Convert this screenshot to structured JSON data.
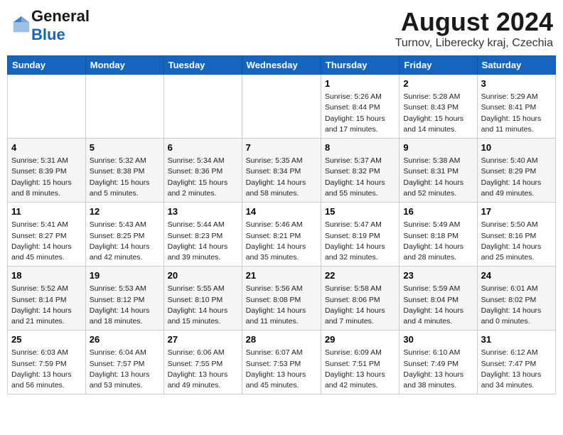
{
  "header": {
    "logo_general": "General",
    "logo_blue": "Blue",
    "month": "August 2024",
    "location": "Turnov, Liberecky kraj, Czechia"
  },
  "weekdays": [
    "Sunday",
    "Monday",
    "Tuesday",
    "Wednesday",
    "Thursday",
    "Friday",
    "Saturday"
  ],
  "weeks": [
    [
      {
        "day": "",
        "info": ""
      },
      {
        "day": "",
        "info": ""
      },
      {
        "day": "",
        "info": ""
      },
      {
        "day": "",
        "info": ""
      },
      {
        "day": "1",
        "info": "Sunrise: 5:26 AM\nSunset: 8:44 PM\nDaylight: 15 hours\nand 17 minutes."
      },
      {
        "day": "2",
        "info": "Sunrise: 5:28 AM\nSunset: 8:43 PM\nDaylight: 15 hours\nand 14 minutes."
      },
      {
        "day": "3",
        "info": "Sunrise: 5:29 AM\nSunset: 8:41 PM\nDaylight: 15 hours\nand 11 minutes."
      }
    ],
    [
      {
        "day": "4",
        "info": "Sunrise: 5:31 AM\nSunset: 8:39 PM\nDaylight: 15 hours\nand 8 minutes."
      },
      {
        "day": "5",
        "info": "Sunrise: 5:32 AM\nSunset: 8:38 PM\nDaylight: 15 hours\nand 5 minutes."
      },
      {
        "day": "6",
        "info": "Sunrise: 5:34 AM\nSunset: 8:36 PM\nDaylight: 15 hours\nand 2 minutes."
      },
      {
        "day": "7",
        "info": "Sunrise: 5:35 AM\nSunset: 8:34 PM\nDaylight: 14 hours\nand 58 minutes."
      },
      {
        "day": "8",
        "info": "Sunrise: 5:37 AM\nSunset: 8:32 PM\nDaylight: 14 hours\nand 55 minutes."
      },
      {
        "day": "9",
        "info": "Sunrise: 5:38 AM\nSunset: 8:31 PM\nDaylight: 14 hours\nand 52 minutes."
      },
      {
        "day": "10",
        "info": "Sunrise: 5:40 AM\nSunset: 8:29 PM\nDaylight: 14 hours\nand 49 minutes."
      }
    ],
    [
      {
        "day": "11",
        "info": "Sunrise: 5:41 AM\nSunset: 8:27 PM\nDaylight: 14 hours\nand 45 minutes."
      },
      {
        "day": "12",
        "info": "Sunrise: 5:43 AM\nSunset: 8:25 PM\nDaylight: 14 hours\nand 42 minutes."
      },
      {
        "day": "13",
        "info": "Sunrise: 5:44 AM\nSunset: 8:23 PM\nDaylight: 14 hours\nand 39 minutes."
      },
      {
        "day": "14",
        "info": "Sunrise: 5:46 AM\nSunset: 8:21 PM\nDaylight: 14 hours\nand 35 minutes."
      },
      {
        "day": "15",
        "info": "Sunrise: 5:47 AM\nSunset: 8:19 PM\nDaylight: 14 hours\nand 32 minutes."
      },
      {
        "day": "16",
        "info": "Sunrise: 5:49 AM\nSunset: 8:18 PM\nDaylight: 14 hours\nand 28 minutes."
      },
      {
        "day": "17",
        "info": "Sunrise: 5:50 AM\nSunset: 8:16 PM\nDaylight: 14 hours\nand 25 minutes."
      }
    ],
    [
      {
        "day": "18",
        "info": "Sunrise: 5:52 AM\nSunset: 8:14 PM\nDaylight: 14 hours\nand 21 minutes."
      },
      {
        "day": "19",
        "info": "Sunrise: 5:53 AM\nSunset: 8:12 PM\nDaylight: 14 hours\nand 18 minutes."
      },
      {
        "day": "20",
        "info": "Sunrise: 5:55 AM\nSunset: 8:10 PM\nDaylight: 14 hours\nand 15 minutes."
      },
      {
        "day": "21",
        "info": "Sunrise: 5:56 AM\nSunset: 8:08 PM\nDaylight: 14 hours\nand 11 minutes."
      },
      {
        "day": "22",
        "info": "Sunrise: 5:58 AM\nSunset: 8:06 PM\nDaylight: 14 hours\nand 7 minutes."
      },
      {
        "day": "23",
        "info": "Sunrise: 5:59 AM\nSunset: 8:04 PM\nDaylight: 14 hours\nand 4 minutes."
      },
      {
        "day": "24",
        "info": "Sunrise: 6:01 AM\nSunset: 8:02 PM\nDaylight: 14 hours\nand 0 minutes."
      }
    ],
    [
      {
        "day": "25",
        "info": "Sunrise: 6:03 AM\nSunset: 7:59 PM\nDaylight: 13 hours\nand 56 minutes."
      },
      {
        "day": "26",
        "info": "Sunrise: 6:04 AM\nSunset: 7:57 PM\nDaylight: 13 hours\nand 53 minutes."
      },
      {
        "day": "27",
        "info": "Sunrise: 6:06 AM\nSunset: 7:55 PM\nDaylight: 13 hours\nand 49 minutes."
      },
      {
        "day": "28",
        "info": "Sunrise: 6:07 AM\nSunset: 7:53 PM\nDaylight: 13 hours\nand 45 minutes."
      },
      {
        "day": "29",
        "info": "Sunrise: 6:09 AM\nSunset: 7:51 PM\nDaylight: 13 hours\nand 42 minutes."
      },
      {
        "day": "30",
        "info": "Sunrise: 6:10 AM\nSunset: 7:49 PM\nDaylight: 13 hours\nand 38 minutes."
      },
      {
        "day": "31",
        "info": "Sunrise: 6:12 AM\nSunset: 7:47 PM\nDaylight: 13 hours\nand 34 minutes."
      }
    ]
  ]
}
